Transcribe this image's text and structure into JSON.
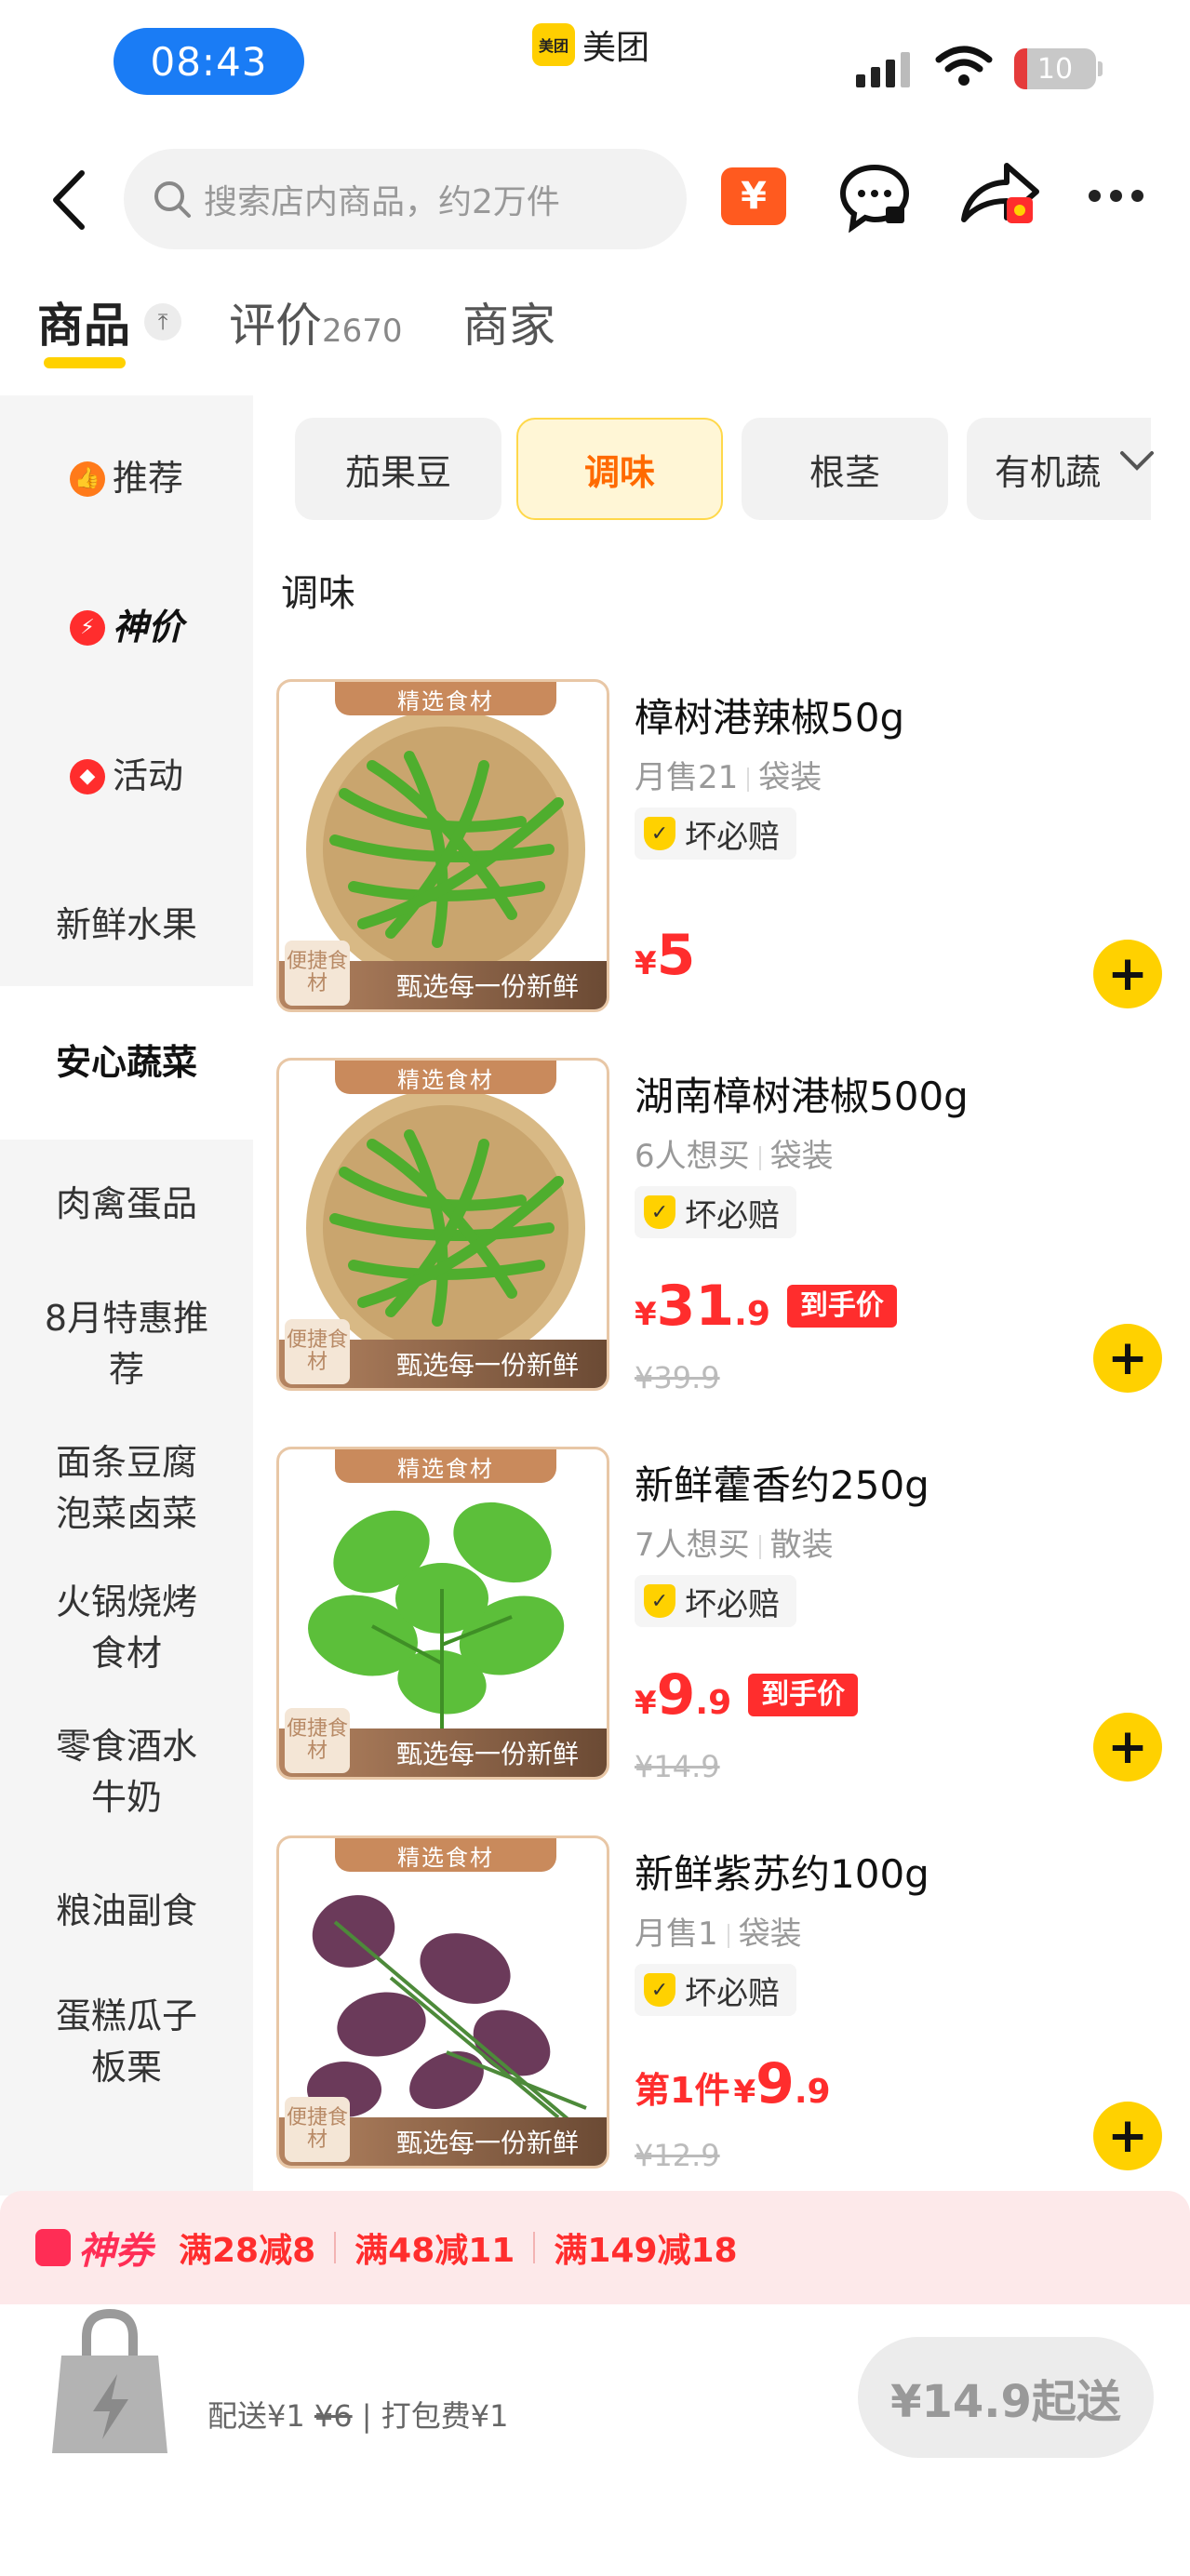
{
  "status_bar": {
    "time": "08:43",
    "app_name": "美团",
    "app_logo_text": "美团",
    "battery": "10"
  },
  "nav": {
    "search_placeholder": "搜索店内商品，约2万件",
    "coupon_symbol": "¥"
  },
  "tabs": [
    {
      "label": "商品",
      "count": ""
    },
    {
      "label": "评价",
      "count": "2670"
    },
    {
      "label": "商家",
      "count": ""
    }
  ],
  "sidebar": {
    "items": [
      {
        "label": "推荐",
        "icon": "thumb-icon",
        "color": "#ff7a1a"
      },
      {
        "label": "神价",
        "icon": "lightning-icon",
        "color": "#ff2d2d"
      },
      {
        "label": "活动",
        "icon": "tag-icon",
        "color": "#ff2d2d"
      },
      {
        "label": "新鲜水果"
      },
      {
        "label": "安心蔬菜",
        "active": true
      },
      {
        "label": "肉禽蛋品"
      },
      {
        "label": "8月特惠推荐"
      },
      {
        "label": "面条豆腐泡菜卤菜"
      },
      {
        "label": "火锅烧烤食材"
      },
      {
        "label": "零食酒水牛奶"
      },
      {
        "label": "粮油副食"
      },
      {
        "label": "蛋糕瓜子板栗"
      }
    ]
  },
  "chips": [
    {
      "label": "茄果豆"
    },
    {
      "label": "调味",
      "active": true
    },
    {
      "label": "根茎"
    },
    {
      "label": "有机蔬"
    }
  ],
  "section_title": "调味",
  "image_overlay": {
    "banner": "精选食材",
    "footer": "甄选每一份新鲜",
    "badge": "便捷食材"
  },
  "products": [
    {
      "name": "樟树港辣椒50g",
      "sales": "月售21",
      "pack": "袋装",
      "guarantee": "坏必赔",
      "price_prefix": "",
      "yen": "¥",
      "price_int": "5",
      "price_dec": "",
      "deal_tag": "",
      "orig_price": "",
      "image": "green-chili"
    },
    {
      "name": "湖南樟树港椒500g",
      "sales": "6人想买",
      "pack": "袋装",
      "guarantee": "坏必赔",
      "price_prefix": "",
      "yen": "¥",
      "price_int": "31",
      "price_dec": ".9",
      "deal_tag": "到手价",
      "orig_price": "¥39.9",
      "image": "green-chili"
    },
    {
      "name": "新鲜藿香约250g",
      "sales": "7人想买",
      "pack": "散装",
      "guarantee": "坏必赔",
      "price_prefix": "",
      "yen": "¥",
      "price_int": "9",
      "price_dec": ".9",
      "deal_tag": "到手价",
      "orig_price": "¥14.9",
      "image": "mint-leaves"
    },
    {
      "name": "新鲜紫苏约100g",
      "sales": "月售1",
      "pack": "袋装",
      "guarantee": "坏必赔",
      "price_prefix": "第1件",
      "yen": "¥",
      "price_int": "9",
      "price_dec": ".9",
      "deal_tag": "",
      "orig_price": "¥12.9",
      "image": "purple-perilla"
    }
  ],
  "coupon_bar": {
    "brand": "神券",
    "items": [
      "满28减8",
      "满48减11",
      "满149减18"
    ]
  },
  "bottom_bar": {
    "fee_prefix": "配送¥1 ",
    "fee_strike": "¥6",
    "fee_suffix": " | 打包费¥1",
    "checkout": "¥14.9起送"
  },
  "colors": {
    "accent": "#ffd100",
    "price": "#ff2d2d",
    "chip_active_text": "#ff6a00"
  }
}
